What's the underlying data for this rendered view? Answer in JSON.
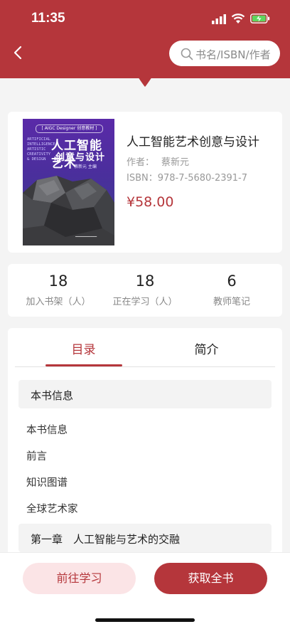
{
  "status_bar": {
    "time": "11:35"
  },
  "header": {
    "search_placeholder": "书名/ISBN/作者",
    "accent_color": "#b5363b"
  },
  "book": {
    "cover": {
      "tag": "[ AIGC Designer 创意教材 ]",
      "title_line1": "人工智能艺术",
      "title_line2": "创意与设计",
      "english": [
        "ARTIFICIAL",
        "INTELLIGENCE",
        "ARTISTIC",
        "CREATIVITY",
        "& DESIGN"
      ],
      "author": "蔡新元 主编"
    },
    "title": "人工智能艺术创意与设计",
    "author_label": "作者：",
    "author": "蔡新元",
    "isbn": "ISBN：978-7-5680-2391-7",
    "price": "¥58.00"
  },
  "stats": [
    {
      "value": "18",
      "label": "加入书架（人）"
    },
    {
      "value": "18",
      "label": "正在学习（人）"
    },
    {
      "value": "6",
      "label": "教师笔记"
    }
  ],
  "tabs": [
    {
      "label": "目录",
      "active": true
    },
    {
      "label": "简介",
      "active": false
    }
  ],
  "toc": {
    "section1": "本书信息",
    "items": [
      "本书信息",
      "前言",
      "知识图谱",
      "全球艺术家"
    ],
    "section2": "第一章　人工智能与艺术的交融"
  },
  "actions": {
    "study": "前往学习",
    "get": "获取全书"
  }
}
